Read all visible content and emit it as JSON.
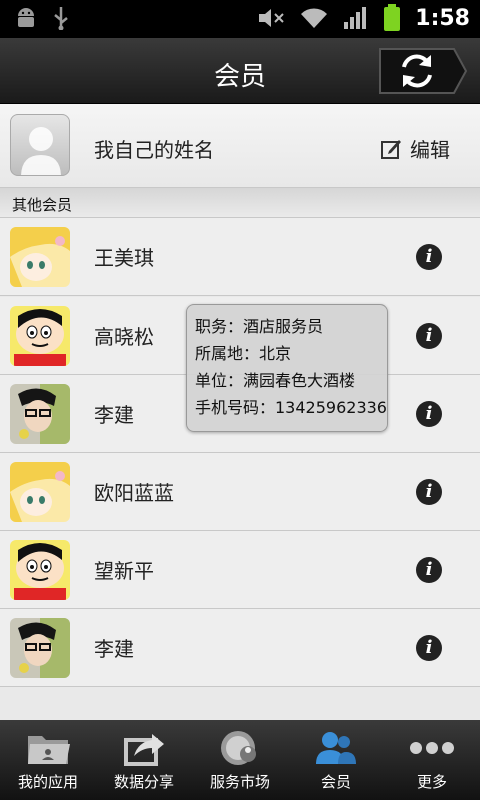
{
  "status_bar": {
    "time": "1:58"
  },
  "header": {
    "title": "会员"
  },
  "self": {
    "name": "我自己的姓名",
    "edit_label": "编辑"
  },
  "section": {
    "label": "其他会员"
  },
  "members": [
    {
      "name": "王美琪",
      "avatar": "blonde-anime-girl"
    },
    {
      "name": "高晓松",
      "avatar": "crayon-shinchan"
    },
    {
      "name": "李建",
      "avatar": "photo-boy"
    },
    {
      "name": "欧阳蓝蓝",
      "avatar": "blonde-anime-girl"
    },
    {
      "name": "望新平",
      "avatar": "crayon-shinchan"
    },
    {
      "name": "李建",
      "avatar": "photo-boy"
    }
  ],
  "tooltip": {
    "position": "职务：酒店服务员",
    "location": "所属地：北京",
    "company": "单位：满园春色大酒楼",
    "phone": "手机号码：13425962336"
  },
  "tabs": [
    {
      "label": "我的应用",
      "icon": "folder-icon"
    },
    {
      "label": "数据分享",
      "icon": "share-icon"
    },
    {
      "label": "服务市场",
      "icon": "market-icon"
    },
    {
      "label": "会员",
      "icon": "members-icon",
      "active": true
    },
    {
      "label": "更多",
      "icon": "more-icon"
    }
  ],
  "colors": {
    "active_tab": "#3a8fd8",
    "battery": "#7ed321"
  }
}
